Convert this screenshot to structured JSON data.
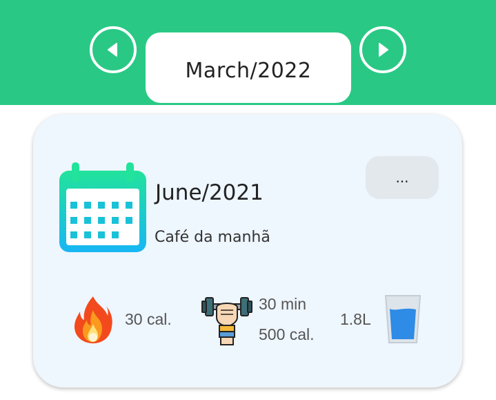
{
  "header": {
    "month_label": "March/2022",
    "prev_icon": "chevron-left-icon",
    "next_icon": "chevron-right-icon"
  },
  "card": {
    "title": "June/2021",
    "subtitle": "Café da manhã",
    "menu_label": "...",
    "stats": {
      "calories": "30 cal.",
      "exercise_time": "30 min",
      "exercise_calories": "500 cal.",
      "water": "1.8L"
    }
  },
  "colors": {
    "header_green": "#29c985",
    "card_background": "#eef6fe",
    "calendar_gradient_top": "#22e39b",
    "calendar_gradient_bottom": "#17b6f4"
  }
}
